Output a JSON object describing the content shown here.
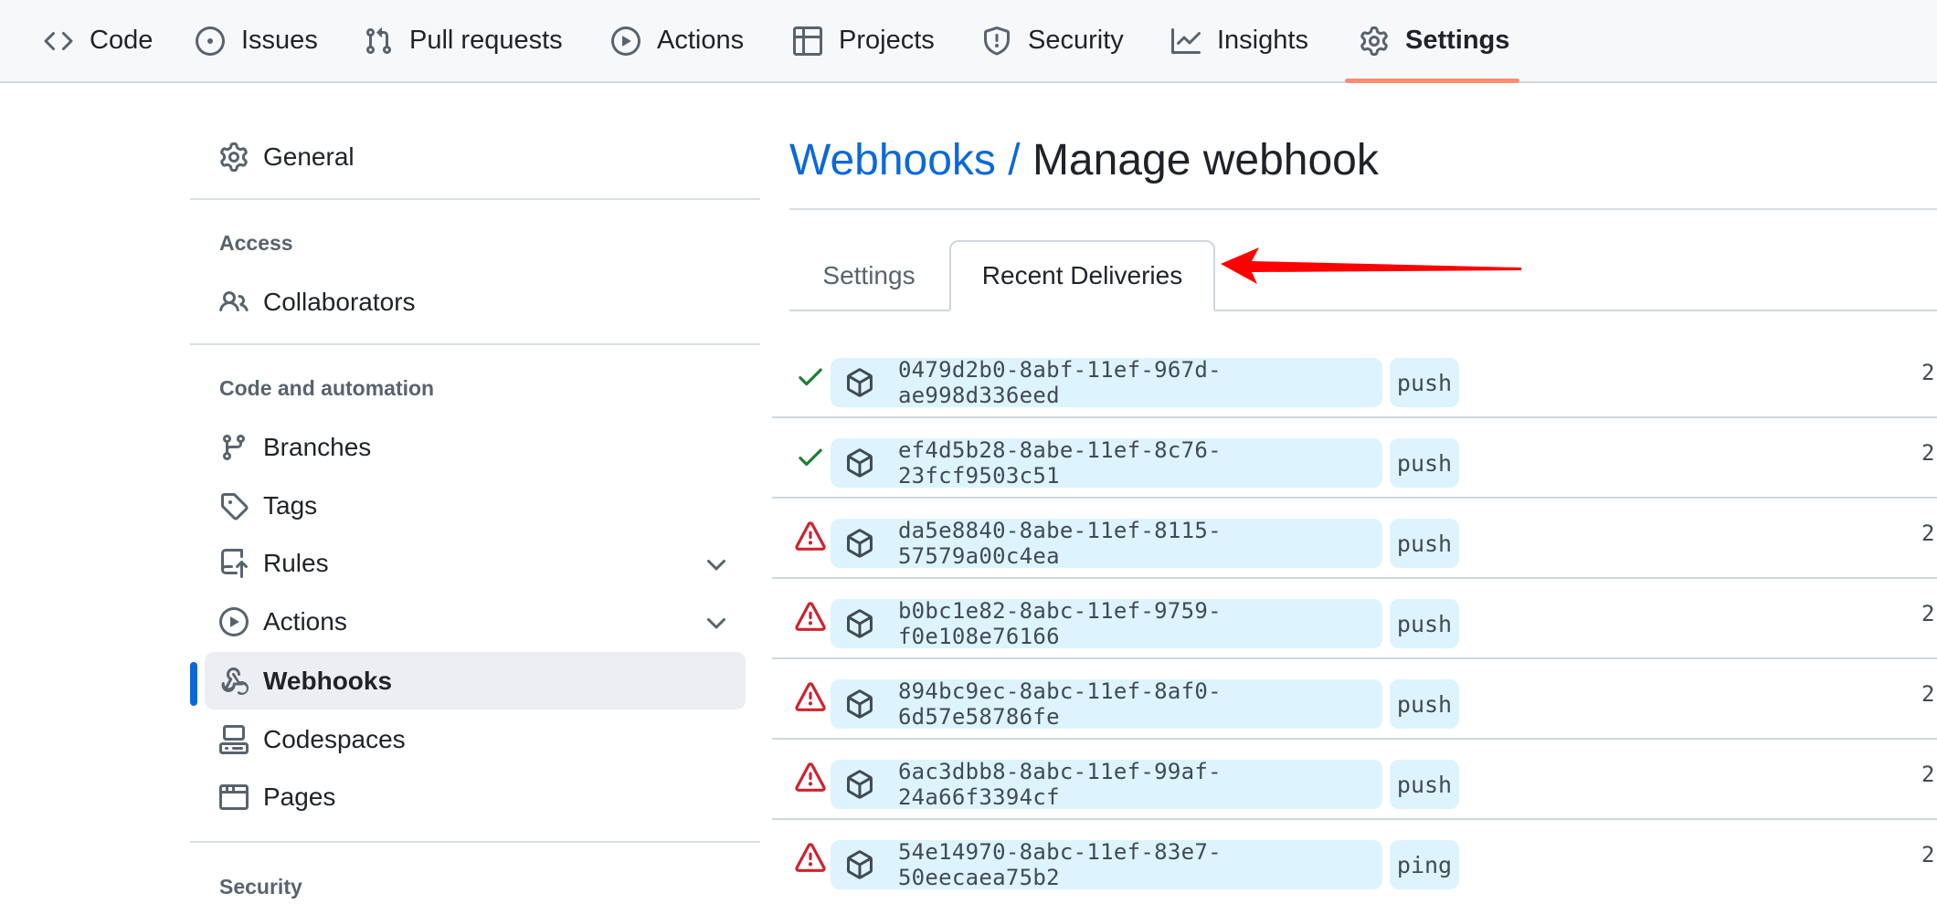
{
  "repo_nav": {
    "tabs": [
      {
        "label": "Code",
        "icon": "code-icon"
      },
      {
        "label": "Issues",
        "icon": "issue-opened-icon"
      },
      {
        "label": "Pull requests",
        "icon": "git-pull-request-icon"
      },
      {
        "label": "Actions",
        "icon": "play-icon"
      },
      {
        "label": "Projects",
        "icon": "table-icon"
      },
      {
        "label": "Security",
        "icon": "shield-icon"
      },
      {
        "label": "Insights",
        "icon": "graph-icon"
      },
      {
        "label": "Settings",
        "icon": "gear-icon",
        "selected": true
      }
    ],
    "underline_color": "#fd8c73"
  },
  "sidebar": {
    "general": {
      "label": "General",
      "icon": "gear-icon"
    },
    "sections": [
      {
        "heading": "Access",
        "items": [
          {
            "label": "Collaborators",
            "icon": "people-icon"
          }
        ]
      },
      {
        "heading": "Code and automation",
        "items": [
          {
            "label": "Branches",
            "icon": "git-branch-icon"
          },
          {
            "label": "Tags",
            "icon": "tag-icon"
          },
          {
            "label": "Rules",
            "icon": "repo-push-icon",
            "expandable": true
          },
          {
            "label": "Actions",
            "icon": "play-icon",
            "expandable": true
          },
          {
            "label": "Webhooks",
            "icon": "webhook-icon",
            "active": true
          },
          {
            "label": "Codespaces",
            "icon": "codespaces-icon"
          },
          {
            "label": "Pages",
            "icon": "browser-icon"
          }
        ]
      },
      {
        "heading": "Security",
        "items": []
      }
    ],
    "active_color": "#0969da"
  },
  "main": {
    "breadcrumb_link": "Webhooks /",
    "title": "Manage webhook",
    "tabs": [
      {
        "label": "Settings",
        "selected": false
      },
      {
        "label": "Recent Deliveries",
        "selected": true
      }
    ],
    "deliveries": [
      {
        "status": "success",
        "guid": "0479d2b0-8abf-11ef-967d-ae998d336eed",
        "event": "push",
        "time": "2"
      },
      {
        "status": "success",
        "guid": "ef4d5b28-8abe-11ef-8c76-23fcf9503c51",
        "event": "push",
        "time": "2"
      },
      {
        "status": "failure",
        "guid": "da5e8840-8abe-11ef-8115-57579a00c4ea",
        "event": "push",
        "time": "2"
      },
      {
        "status": "failure",
        "guid": "b0bc1e82-8abc-11ef-9759-f0e108e76166",
        "event": "push",
        "time": "2"
      },
      {
        "status": "failure",
        "guid": "894bc9ec-8abc-11ef-8af0-6d57e58786fe",
        "event": "push",
        "time": "2"
      },
      {
        "status": "failure",
        "guid": "6ac3dbb8-8abc-11ef-99af-24a66f3394cf",
        "event": "push",
        "time": "2"
      },
      {
        "status": "failure",
        "guid": "54e14970-8abc-11ef-83e7-50eecaea75b2",
        "event": "ping",
        "time": "2"
      }
    ],
    "colors": {
      "success": "#1a7f37",
      "failure": "#cf222e",
      "link": "#0969da",
      "label_bg": "#ddf4ff"
    }
  },
  "annotation": {
    "arrow_color": "#ff0000",
    "target": "Recent Deliveries tab"
  }
}
